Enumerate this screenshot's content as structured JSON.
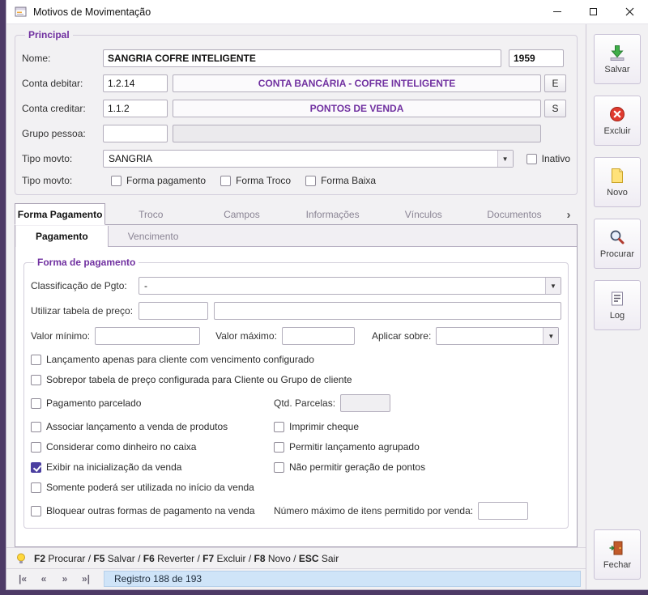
{
  "colors": {
    "accent": "#7030a0",
    "check_bg": "#4b3fa0",
    "record_bg": "#cfe4f8",
    "frame_bg": "#4d3a66"
  },
  "window": {
    "title": "Motivos de Movimentação"
  },
  "principal": {
    "legend": "Principal",
    "nome": {
      "label": "Nome:",
      "value": "SANGRIA COFRE INTELIGENTE",
      "code": "1959"
    },
    "conta_debitar": {
      "label": "Conta debitar:",
      "code": "1.2.14",
      "desc": "CONTA BANCÁRIA - COFRE INTELIGENTE",
      "button": "E"
    },
    "conta_creditar": {
      "label": "Conta creditar:",
      "code": "1.1.2",
      "desc": "PONTOS DE VENDA",
      "button": "S"
    },
    "grupo_pessoa": {
      "label": "Grupo pessoa:",
      "code": "",
      "desc": ""
    },
    "tipo_movto": {
      "label": "Tipo movto:",
      "value": "SANGRIA",
      "inativo": {
        "label": "Inativo",
        "checked": false
      }
    },
    "flags": {
      "label": "Tipo movto:",
      "options": [
        {
          "label": "Forma pagamento",
          "checked": false
        },
        {
          "label": "Forma Troco",
          "checked": false
        },
        {
          "label": "Forma Baixa",
          "checked": false
        }
      ]
    }
  },
  "tabs": {
    "items": [
      "Forma Pagamento",
      "Troco",
      "Campos",
      "Informações",
      "Vínculos",
      "Documentos"
    ],
    "active": "Forma Pagamento",
    "scroll_icon": "›"
  },
  "subtabs": {
    "items": [
      "Pagamento",
      "Vencimento"
    ],
    "active": "Pagamento"
  },
  "payment": {
    "legend": "Forma de pagamento",
    "classificacao": {
      "label": "Classificação de Pgto:",
      "value": "-"
    },
    "tabela_preco": {
      "label": "Utilizar tabela de preço:",
      "code": "",
      "desc": ""
    },
    "valor_minimo": {
      "label": "Valor mínimo:",
      "value": ""
    },
    "valor_maximo": {
      "label": "Valor máximo:",
      "value": ""
    },
    "aplicar_sobre": {
      "label": "Aplicar sobre:",
      "value": ""
    },
    "qtd_parcelas": {
      "label": "Qtd. Parcelas:",
      "value": ""
    },
    "num_max_itens": {
      "label": "Número máximo de itens permitido por venda:",
      "value": ""
    },
    "checks": {
      "vencimento_configurado": {
        "label": "Lançamento apenas para cliente com vencimento configurado",
        "checked": false
      },
      "sobrepor_tabela": {
        "label": "Sobrepor tabela de preço configurada para Cliente ou Grupo de cliente",
        "checked": false
      },
      "pagamento_parcelado": {
        "label": "Pagamento parcelado",
        "checked": false
      },
      "associar_venda": {
        "label": "Associar lançamento a venda de produtos",
        "checked": false
      },
      "imprimir_cheque": {
        "label": "Imprimir cheque",
        "checked": false
      },
      "dinheiro_caixa": {
        "label": "Considerar como dinheiro no caixa",
        "checked": false
      },
      "lancamento_agrupado": {
        "label": "Permitir lançamento agrupado",
        "checked": false
      },
      "exibir_inicializacao": {
        "label": "Exibir na inicialização da venda",
        "checked": true
      },
      "nao_gerar_pontos": {
        "label": "Não permitir geração de pontos",
        "checked": false
      },
      "somente_inicio": {
        "label": "Somente poderá ser utilizada no início da venda",
        "checked": false
      },
      "bloquear_outras": {
        "label": "Bloquear outras formas de pagamento na venda",
        "checked": false
      }
    }
  },
  "sidebar": {
    "buttons": [
      {
        "label": "Salvar"
      },
      {
        "label": "Excluir"
      },
      {
        "label": "Novo"
      },
      {
        "label": "Procurar"
      },
      {
        "label": "Log"
      },
      {
        "label": "Fechar"
      }
    ]
  },
  "statusbar": {
    "keys": [
      "F2",
      "F5",
      "F6",
      "F7",
      "F8",
      "ESC"
    ],
    "actions": [
      " Procurar / ",
      " Salvar / ",
      " Reverter / ",
      " Excluir / ",
      " Novo / ",
      " Sair"
    ]
  },
  "navbar": {
    "buttons": [
      "|«",
      "«",
      "»",
      "»|"
    ],
    "record_text": "Registro 188 de 193"
  }
}
